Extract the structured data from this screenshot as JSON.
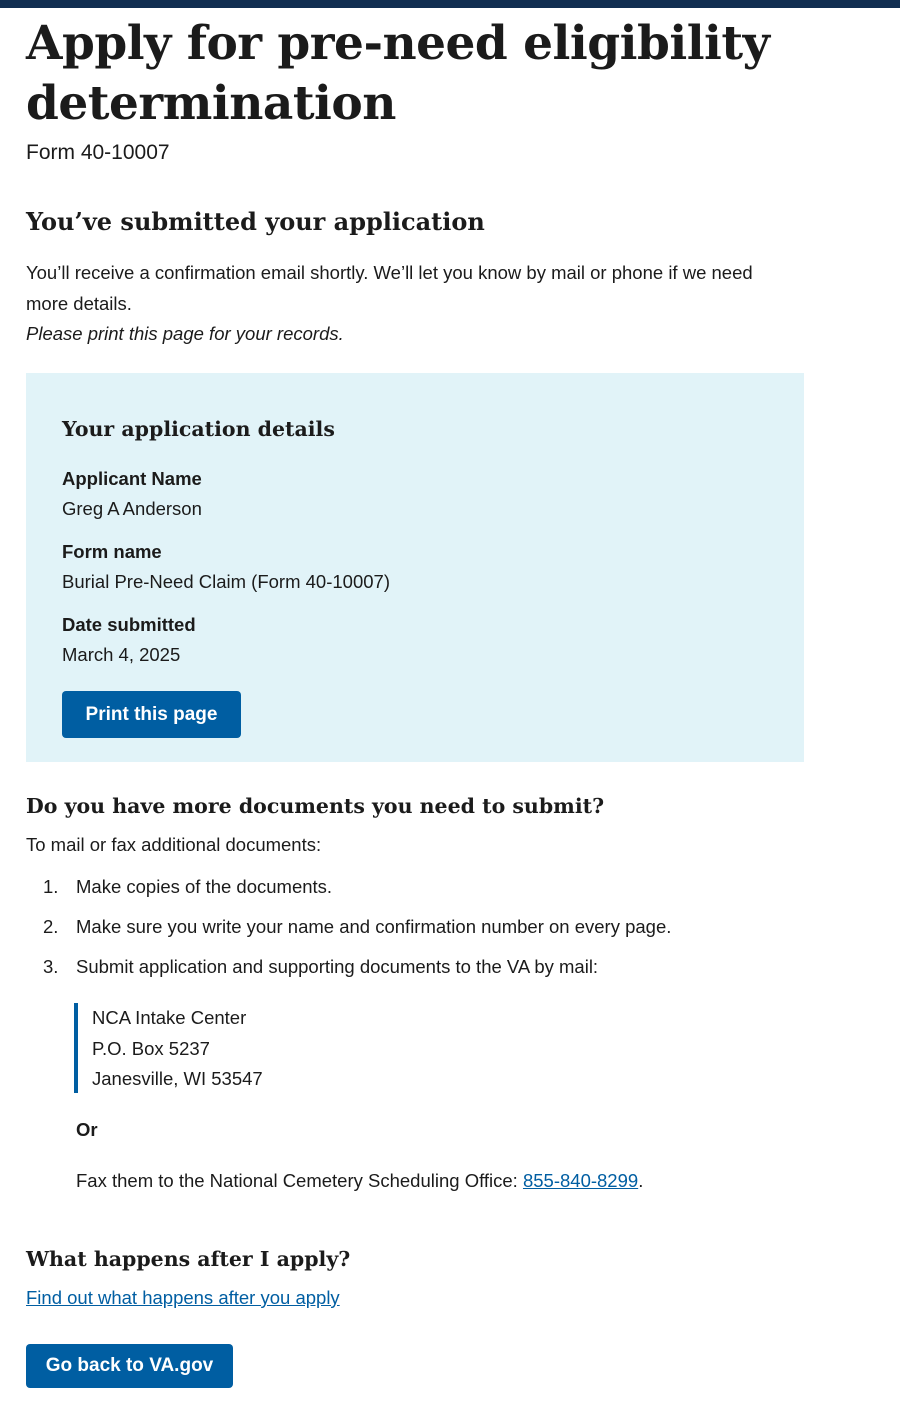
{
  "header": {
    "title": "Apply for pre-need eligibility determination",
    "form_number": "Form 40-10007"
  },
  "confirmation": {
    "heading": "You’ve submitted your application",
    "message": "You’ll receive a confirmation email shortly. We’ll let you know by mail or phone if we need more details.",
    "print_note": "Please print this page for your records."
  },
  "details": {
    "heading": "Your application details",
    "applicant_label": "Applicant Name",
    "applicant_value": "Greg A Anderson",
    "form_name_label": "Form name",
    "form_name_value": "Burial Pre-Need Claim (Form 40-10007)",
    "date_label": "Date submitted",
    "date_value": "March 4, 2025",
    "print_button": "Print this page"
  },
  "documents": {
    "heading": "Do you have more documents you need to submit?",
    "intro": "To mail or fax additional documents:",
    "steps": [
      {
        "num": "1.",
        "text": "Make copies of the documents."
      },
      {
        "num": "2.",
        "text": "Make sure you write your name and confirmation number on every page."
      },
      {
        "num": "3.",
        "text": "Submit application and supporting documents to the VA by mail:"
      }
    ],
    "address": [
      "NCA Intake Center",
      "P.O. Box 5237",
      "Janesville, WI 53547"
    ],
    "or_label": "Or",
    "fax_text": "Fax them to the National Cemetery Scheduling Office: ",
    "fax_number": "855-840-8299",
    "fax_end": "."
  },
  "after": {
    "heading": "What happens after I apply?",
    "link_text": "Find out what happens after you apply",
    "back_button": "Go back to VA.gov"
  },
  "colors": {
    "topbar": "#112e51",
    "primary": "#005ea2",
    "details_bg": "#e1f3f8"
  }
}
